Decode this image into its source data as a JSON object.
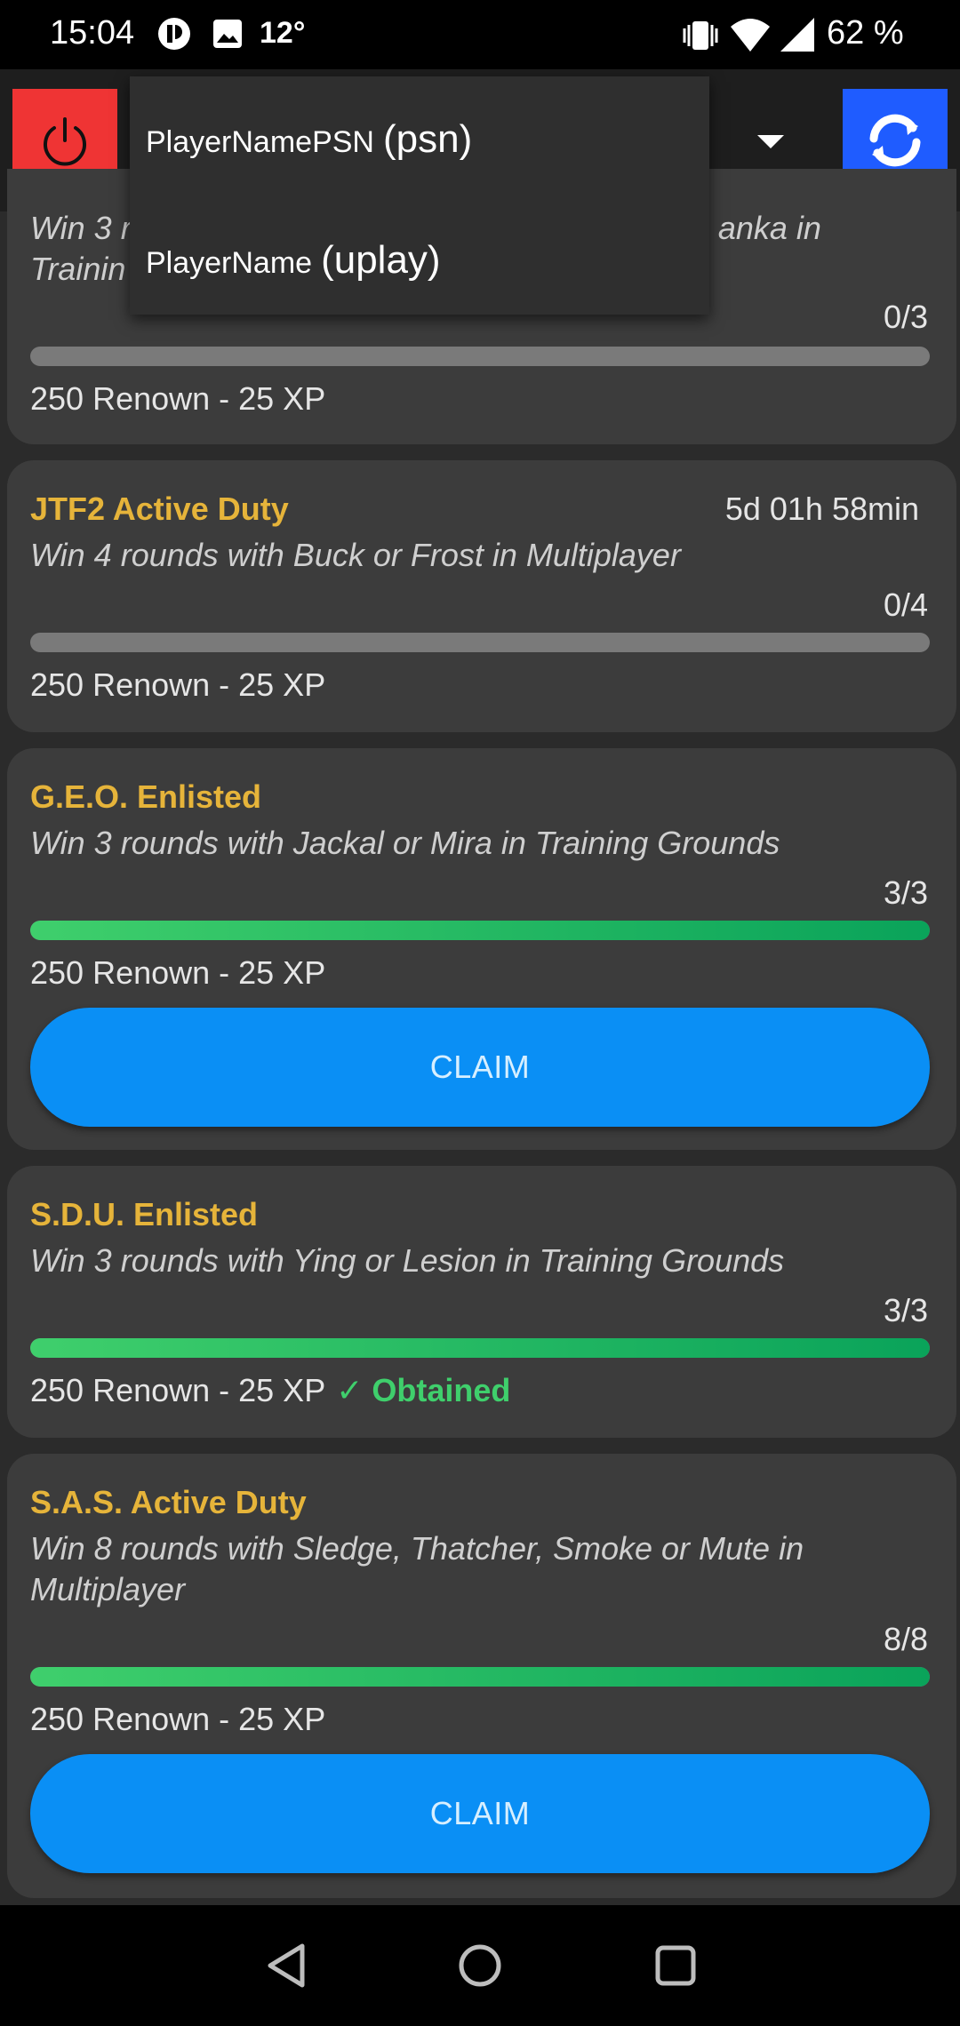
{
  "status_bar": {
    "time": "15:04",
    "temperature": "12°",
    "battery": "62 %"
  },
  "toolbar": {
    "power_icon": "power-icon",
    "refresh_icon": "refresh-icon",
    "power_color": "#ef3434",
    "refresh_color": "#1f5cff"
  },
  "dropdown": {
    "options": [
      {
        "name": "PlayerNamePSN",
        "platform": "(psn)"
      },
      {
        "name": "PlayerName",
        "platform": "(uplay)"
      }
    ]
  },
  "challenges": [
    {
      "title": "",
      "description": "Win 3 r                                                                  anka in Trainin",
      "progress_text": "0/3",
      "progress": 0,
      "reward": "250 Renown - 25 XP"
    },
    {
      "title": "JTF2 Active Duty",
      "timer": "5d 01h 58min",
      "description": "Win 4 rounds with Buck or Frost in Multiplayer",
      "progress_text": "0/4",
      "progress": 0,
      "reward": "250 Renown - 25 XP"
    },
    {
      "title": "G.E.O. Enlisted",
      "description": "Win 3 rounds with Jackal or Mira in Training Grounds",
      "progress_text": "3/3",
      "progress": 1,
      "reward": "250 Renown - 25 XP",
      "button": "CLAIM"
    },
    {
      "title": "S.D.U. Enlisted",
      "description": "Win 3 rounds with Ying or Lesion in Training Grounds",
      "progress_text": "3/3",
      "progress": 1,
      "reward": "250 Renown - 25 XP",
      "status": "✓ Obtained"
    },
    {
      "title": "S.A.S. Active Duty",
      "description": "Win 8 rounds with Sledge, Thatcher, Smoke or Mute in Multiplayer",
      "progress_text": "8/8",
      "progress": 1,
      "reward": "250 Renown - 25 XP",
      "button": "CLAIM"
    }
  ],
  "colors": {
    "title": "#e6b43a",
    "progress_complete": "#3fcf6c",
    "claim_button": "#0a8ff5"
  }
}
